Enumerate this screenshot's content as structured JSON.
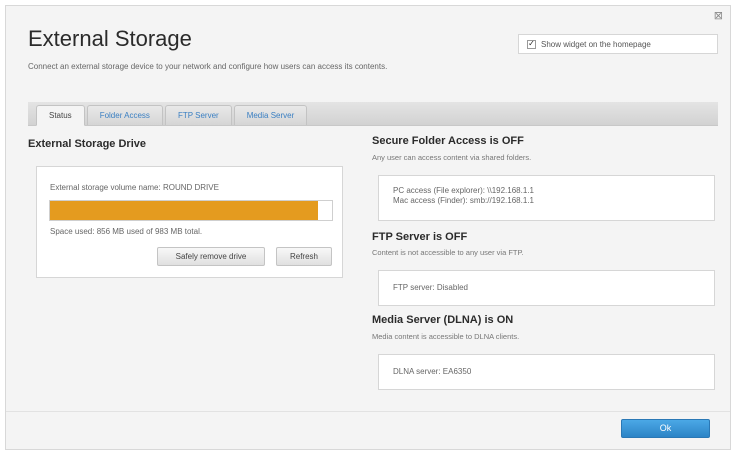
{
  "dialog": {
    "close_glyph": "⊠",
    "title": "External Storage",
    "subtitle": "Connect an external storage device to your network and configure how users can access its contents.",
    "show_widget_label": "Show widget on the homepage",
    "show_widget_checked": true
  },
  "tabs": [
    {
      "label": "Status",
      "active": true
    },
    {
      "label": "Folder Access",
      "active": false
    },
    {
      "label": "FTP Server",
      "active": false
    },
    {
      "label": "Media Server",
      "active": false
    }
  ],
  "drive": {
    "heading": "External Storage Drive",
    "volume_name": "External storage volume name: ROUND DRIVE",
    "used_fraction": 0.95,
    "space_used": "Space used: 856 MB used of 983 MB total.",
    "safely_remove_label": "Safely remove drive",
    "refresh_label": "Refresh"
  },
  "secure_folder": {
    "heading": "Secure Folder Access is OFF",
    "desc": "Any user can access content via shared folders.",
    "pc_access": "PC access (File explorer): \\\\192.168.1.1",
    "mac_access": "Mac access (Finder): smb://192.168.1.1"
  },
  "ftp": {
    "heading": "FTP Server is OFF",
    "desc": "Content is not accessible to any user via FTP.",
    "server": "FTP server: Disabled"
  },
  "media": {
    "heading": "Media Server (DLNA) is ON",
    "desc": "Media content is accessible to DLNA clients.",
    "server": "DLNA server: EA6350"
  },
  "footer": {
    "ok_label": "Ok"
  },
  "colors": {
    "accent": "#2c84c6",
    "progress": "#e49b1f"
  }
}
